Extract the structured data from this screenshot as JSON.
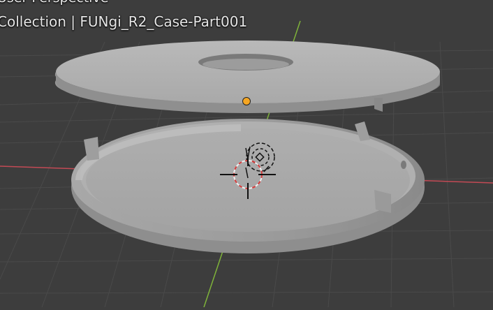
{
  "viewport": {
    "view_mode": "User Perspective",
    "collection_line": "Collection | FUNgi_R2_Case-Part001",
    "colors": {
      "background": "#3d3d3d",
      "grid_line": "#4a4a4a",
      "x_axis": "#c34a55",
      "y_axis": "#7fb33a",
      "origin_point": "#f5a623",
      "mesh_light": "#b4b4b4",
      "mesh_shadow": "#8a8a8a"
    }
  },
  "scene": {
    "objects": [
      {
        "name": "lid",
        "description": "flat disc with center hole"
      },
      {
        "name": "base",
        "description": "shallow round tray with rim and clips"
      }
    ],
    "gizmos": [
      "3d-cursor-icon",
      "object-origin-icon",
      "light-object-icon"
    ]
  }
}
